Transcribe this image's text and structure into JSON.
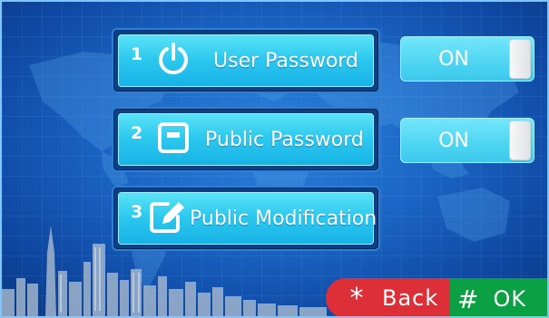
{
  "menu": [
    {
      "number": "1",
      "label": "User Password",
      "icon": "power-icon"
    },
    {
      "number": "2",
      "label": "Public Password",
      "icon": "square-card-icon"
    },
    {
      "number": "3",
      "label": "Public Modification",
      "icon": "edit-pencil-icon"
    }
  ],
  "toggles": [
    {
      "label": "ON",
      "state": "on"
    },
    {
      "label": "ON",
      "state": "on"
    }
  ],
  "actions": {
    "back_symbol": "*",
    "back_label": "Back",
    "ok_symbol": "#",
    "ok_label": "OK"
  },
  "colors": {
    "background": "#1a64c4",
    "button_cyan": "#2ec9ef",
    "back_red": "#dd2f37",
    "ok_green": "#0aa043"
  }
}
